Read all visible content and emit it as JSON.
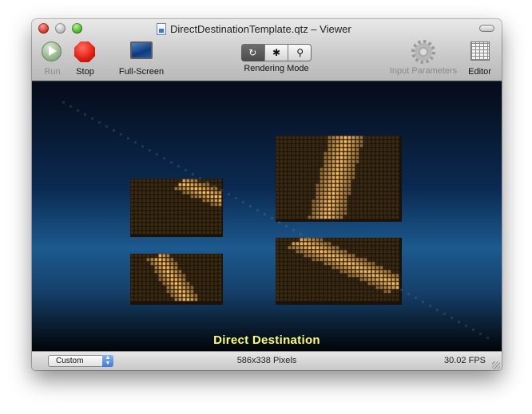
{
  "window": {
    "title": "DirectDestinationTemplate.qtz – Viewer"
  },
  "toolbar": {
    "run_label": "Run",
    "stop_label": "Stop",
    "fullscreen_label": "Full-Screen",
    "rendering_mode_label": "Rendering Mode",
    "rendering_modes": [
      {
        "name": "reload-icon",
        "glyph": "↻"
      },
      {
        "name": "bug-icon",
        "glyph": "✱"
      },
      {
        "name": "magnifier-icon",
        "glyph": "⚲"
      }
    ],
    "input_parameters_label": "Input Parameters",
    "editor_label": "Editor"
  },
  "viewer": {
    "caption": "Direct Destination"
  },
  "status": {
    "size_preset": "Custom",
    "dimensions": "586x338 Pixels",
    "fps": "30.02 FPS"
  },
  "colors": {
    "caption": "#ffff66",
    "led_on": "#ffbe5c",
    "led_off": "#3a2a12",
    "background_top": "#050b18",
    "background_mid": "#1c5a8f"
  }
}
